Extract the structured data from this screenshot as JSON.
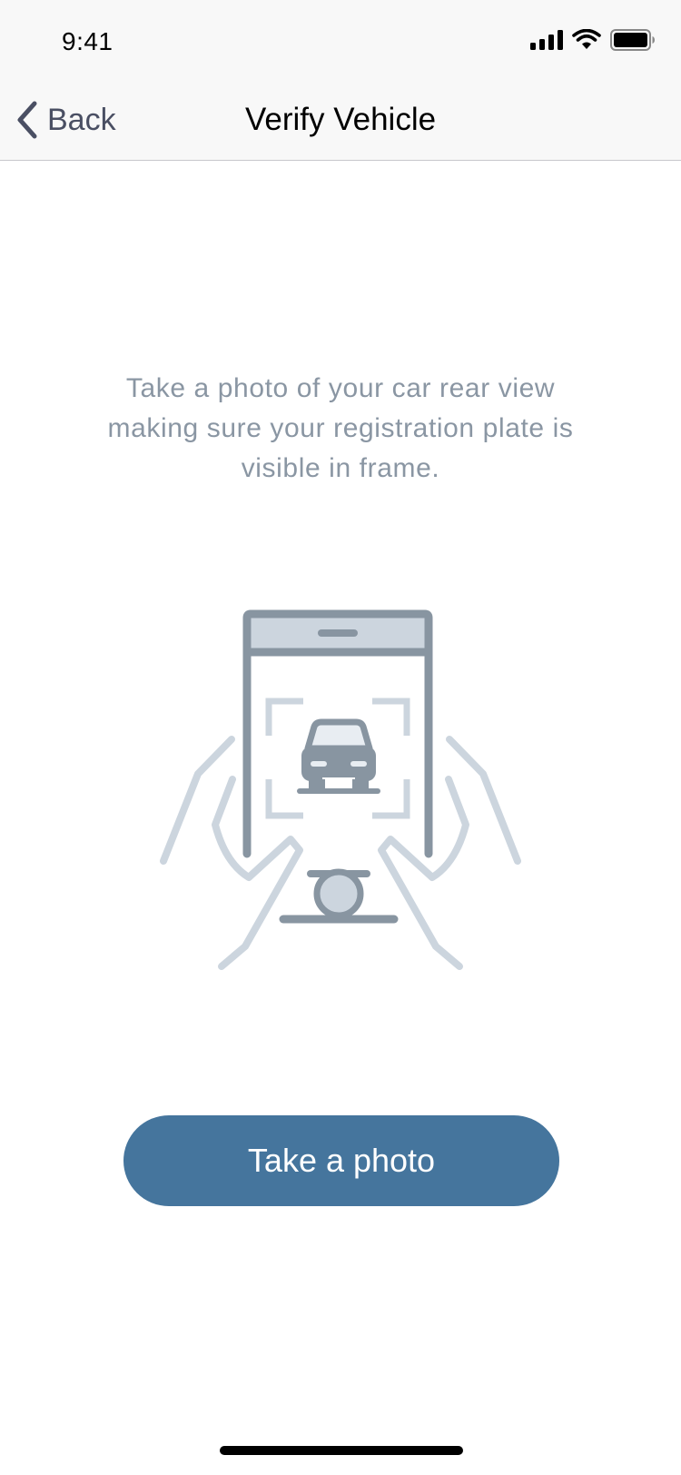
{
  "status_bar": {
    "time": "9:41"
  },
  "nav": {
    "back_label": "Back",
    "title": "Verify Vehicle"
  },
  "content": {
    "instructions": "Take a photo of your car rear view making sure your registration plate is visible in frame."
  },
  "actions": {
    "primary_label": "Take a photo"
  },
  "colors": {
    "primary": "#45759d",
    "illustration_dark": "#8895a1",
    "illustration_light": "#ccd5de",
    "instruction_text": "#8a96a3",
    "back_text": "#4a4f63"
  },
  "icons": {
    "back": "chevron-left-icon",
    "signal": "cellular-signal-icon",
    "wifi": "wifi-icon",
    "battery": "battery-icon",
    "illustration": "phone-camera-car-illustration"
  }
}
